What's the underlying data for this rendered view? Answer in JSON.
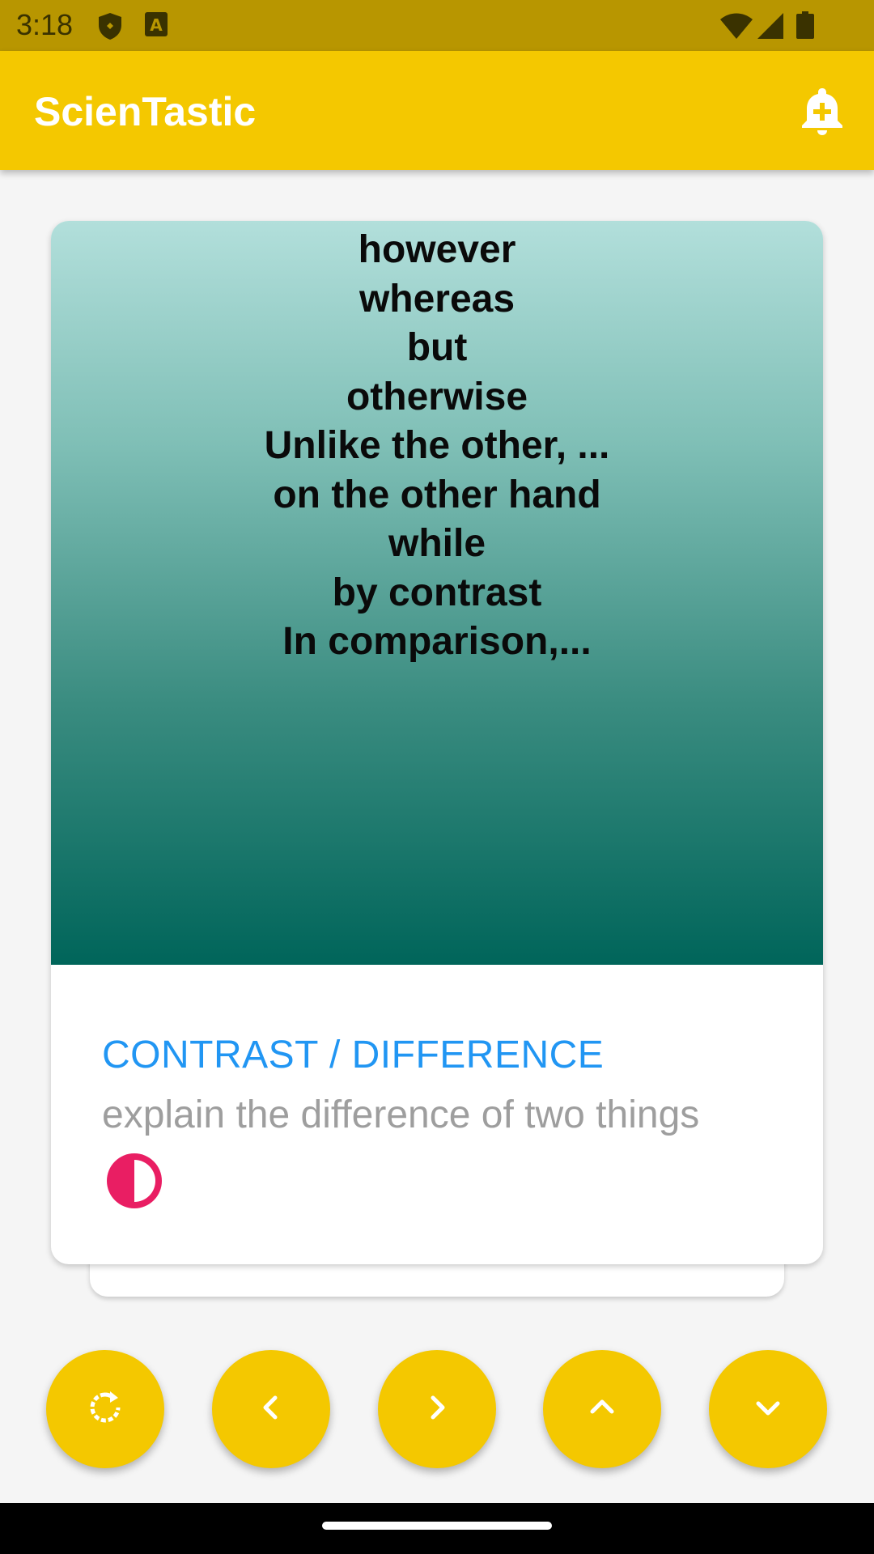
{
  "status_bar": {
    "time": "3:18",
    "icons": [
      "shield-icon",
      "font-a-icon",
      "wifi-icon",
      "signal-icon",
      "battery-icon"
    ]
  },
  "app_bar": {
    "title": "ScienTastic",
    "action_icon": "bell-plus-icon"
  },
  "card": {
    "words": [
      "however",
      "whereas",
      "but",
      "otherwise",
      "Unlike the other, ...",
      "on the other hand",
      "while",
      "by contrast",
      "In comparison,..."
    ],
    "title": "CONTRAST / DIFFERENCE",
    "subtitle": "explain the difference of two things",
    "icon": "half-circle-contrast-icon"
  },
  "fabs": [
    {
      "name": "refresh-button",
      "icon": "refresh-icon"
    },
    {
      "name": "previous-button",
      "icon": "chevron-left-icon"
    },
    {
      "name": "next-button",
      "icon": "chevron-right-icon"
    },
    {
      "name": "up-button",
      "icon": "chevron-up-icon"
    },
    {
      "name": "down-button",
      "icon": "chevron-down-icon"
    }
  ],
  "colors": {
    "app_bar": "#F4C800",
    "status_bar": "#B89600",
    "title_blue": "#2196F3",
    "subtitle_gray": "#9E9E9E",
    "accent_pink": "#E91E63",
    "gradient_top": "#B2DFDB",
    "gradient_bottom": "#00655A"
  }
}
